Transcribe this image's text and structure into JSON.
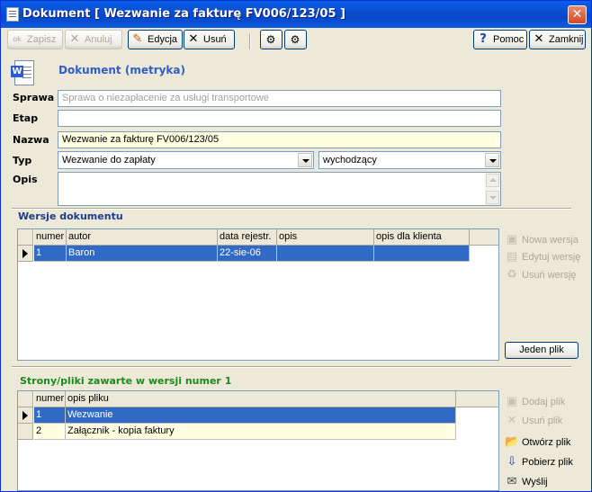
{
  "window": {
    "title": "Dokument [ Wezwanie za fakturę FV006/123/05 ]",
    "close_glyph": "✕"
  },
  "toolbar": {
    "save_label": "Zapisz",
    "cancel_label": "Anuluj",
    "edit_label": "Edycja",
    "delete_label": "Usuń",
    "help_label": "Pomoc",
    "close_label": "Zamknij"
  },
  "header": {
    "section_title": "Dokument (metryka)"
  },
  "form": {
    "sprawa_label": "Sprawa",
    "sprawa_value": "Sprawa o niezapłacenie za usługi transportowe",
    "etap_label": "Etap",
    "etap_value": "",
    "nazwa_label": "Nazwa",
    "nazwa_value": "Wezwanie za fakturę FV006/123/05",
    "typ_label": "Typ",
    "typ_value": "Wezwanie do zapłaty",
    "direction_value": "wychodzący",
    "opis_label": "Opis",
    "opis_value": ""
  },
  "versions": {
    "title": "Wersje dokumentu",
    "columns": [
      "numer",
      "autor",
      "data rejestr.",
      "opis",
      "opis dla klienta"
    ],
    "rows": [
      {
        "numer": "1",
        "autor": "Baron",
        "data": "22-sie-06",
        "opis": "",
        "opis_klient": ""
      }
    ],
    "actions": {
      "new_label": "Nowa wersja",
      "edit_label": "Edytuj wersję",
      "delete_label": "Usuń wersję",
      "single_file_label": "Jeden plik"
    }
  },
  "files": {
    "title": "Strony/pliki zawarte w wersji numer 1",
    "columns": [
      "numer",
      "opis pliku"
    ],
    "rows": [
      {
        "numer": "1",
        "opis": "Wezwanie"
      },
      {
        "numer": "2",
        "opis": "Załącznik - kopia faktury"
      }
    ],
    "actions": {
      "add_label": "Dodaj plik",
      "delete_label": "Usuń plik",
      "open_label": "Otwórz plik",
      "download_label": "Pobierz plik",
      "send_label": "Wyślij"
    }
  },
  "colors": {
    "title_bar": "#0a4ed0",
    "selection": "#316ac5",
    "heading_blue": "#2f5ec8",
    "heading_green": "#1c8a1c",
    "readonly_yellow": "#ffffe1"
  }
}
